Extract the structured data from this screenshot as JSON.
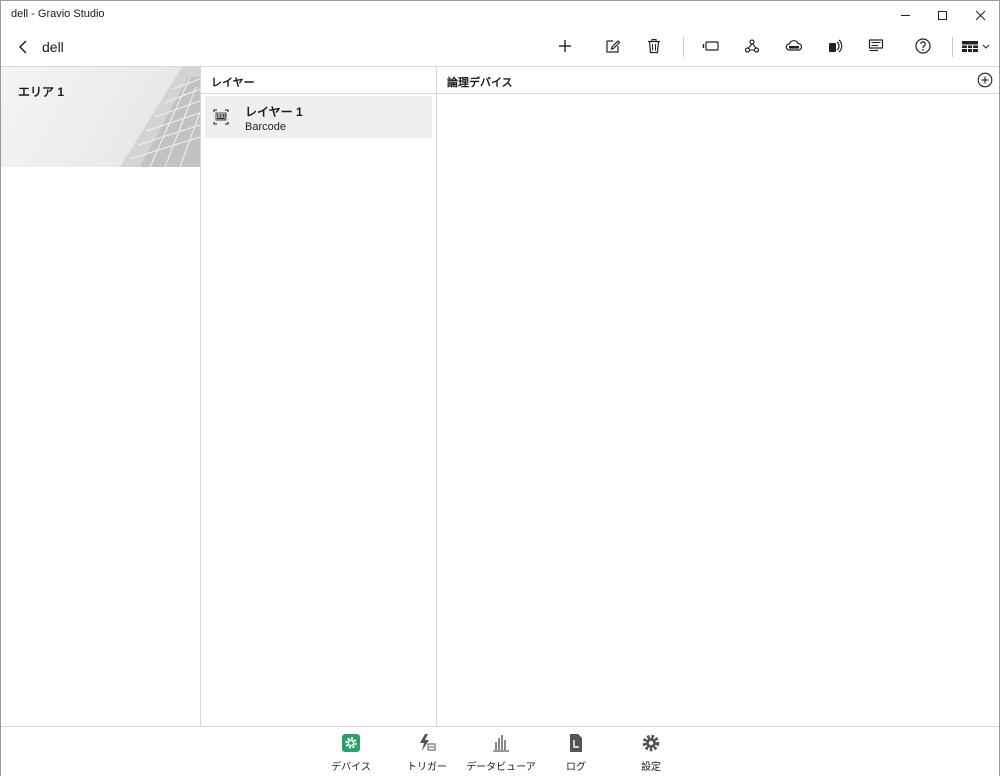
{
  "window": {
    "title": "dell - Gravio Studio"
  },
  "toolbar": {
    "page_title": "dell",
    "buttons": [
      {
        "name": "add",
        "icon": "plus-icon"
      },
      {
        "name": "edit",
        "icon": "edit-icon"
      },
      {
        "name": "delete",
        "icon": "trash-icon"
      },
      {
        "name": "device",
        "icon": "device-icon"
      },
      {
        "name": "webhook",
        "icon": "webhook-icon"
      },
      {
        "name": "mqtt",
        "icon": "mqtt-cloud-icon"
      },
      {
        "name": "nfc",
        "icon": "nfc-icon"
      },
      {
        "name": "list",
        "icon": "list-icon"
      },
      {
        "name": "help",
        "icon": "help-icon"
      },
      {
        "name": "view",
        "icon": "view-grid-icon"
      }
    ]
  },
  "areas": {
    "items": [
      {
        "name": "エリア 1"
      }
    ]
  },
  "layers": {
    "header": "レイヤー",
    "items": [
      {
        "name": "レイヤー 1",
        "type": "Barcode",
        "icon": "barcode-icon"
      }
    ]
  },
  "logical_devices": {
    "header": "論理デバイス"
  },
  "bottom_nav": {
    "accent_color": "#2e9e6e",
    "items": [
      {
        "label": "デバイス",
        "icon": "device-gear-icon",
        "active": true
      },
      {
        "label": "トリガー",
        "icon": "trigger-icon",
        "active": false
      },
      {
        "label": "データビューア",
        "icon": "chart-icon",
        "active": false
      },
      {
        "label": "ログ",
        "icon": "log-icon",
        "active": false
      },
      {
        "label": "設定",
        "icon": "settings-icon",
        "active": false
      }
    ]
  }
}
